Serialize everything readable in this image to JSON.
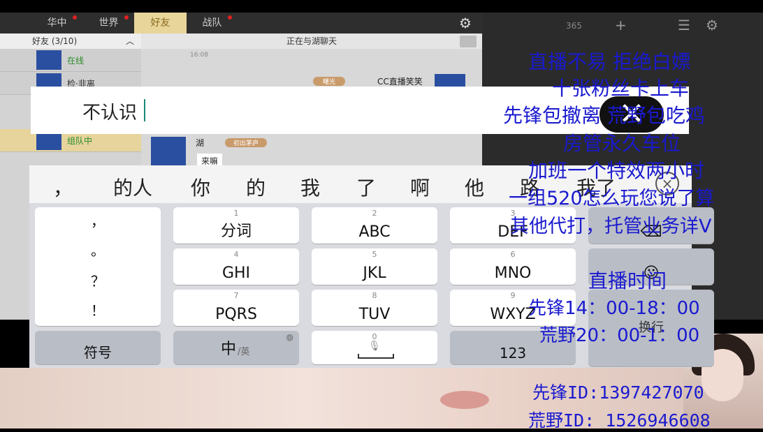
{
  "game": {
    "tabs": [
      {
        "label": "华中",
        "dot": true
      },
      {
        "label": "世界",
        "dot": true
      },
      {
        "label": "好友",
        "dot": false,
        "active": true
      },
      {
        "label": "战队",
        "dot": true
      }
    ],
    "friends_header": "好友 (3/10)",
    "chat_header": "正在与湖聊天",
    "friends": [
      {
        "status": "在线"
      },
      {
        "status": "检·非离"
      },
      {
        "status": "组队中"
      }
    ],
    "chat": {
      "time": "16:08",
      "tag1": "曙光",
      "sender": "CC直播笑笑",
      "sender2": "湖",
      "tag2": "初出茅庐",
      "message": "来嘛"
    },
    "right_counter": "365"
  },
  "input": {
    "text": "不认识"
  },
  "candidates": [
    "，",
    "的人",
    "你",
    "的",
    "我",
    "了",
    "啊",
    "他",
    "路",
    "我了"
  ],
  "keyboard": {
    "punct_keys": [
      "，",
      "。",
      "？",
      "！"
    ],
    "keys": [
      {
        "num": "1",
        "label": "分词"
      },
      {
        "num": "2",
        "label": "ABC"
      },
      {
        "num": "3",
        "label": "DEF"
      },
      {
        "num": "4",
        "label": "GHI"
      },
      {
        "num": "5",
        "label": "JKL"
      },
      {
        "num": "6",
        "label": "MNO"
      },
      {
        "num": "7",
        "label": "PQRS"
      },
      {
        "num": "8",
        "label": "TUV"
      },
      {
        "num": "9",
        "label": "WXYZ"
      }
    ],
    "symbol_key": "符号",
    "lang_key_main": "中",
    "lang_key_sub": "/英",
    "space_num": "0",
    "num_key": "123",
    "enter_key": "换行",
    "emoji": "☺"
  },
  "overlay": {
    "lines": [
      "直播不易   拒绝白嫖",
      "十张粉丝卡上车",
      "先锋包撤离  荒野包吃鸡",
      "房管永久车位",
      "加班一个特效两小时",
      "一组520怎么玩您说了算",
      "其他代打，托管业务详V",
      "直播时间",
      "先锋14：00-18：00",
      "荒野20：00-1：00"
    ],
    "id1": "先锋ID:1397427070",
    "id2": "荒野ID: 1526946608"
  },
  "icons": {
    "gear": "gear-icon",
    "close": "close-icon",
    "mic": "mic-icon",
    "globe": "globe-icon",
    "trash": "trash-icon"
  }
}
